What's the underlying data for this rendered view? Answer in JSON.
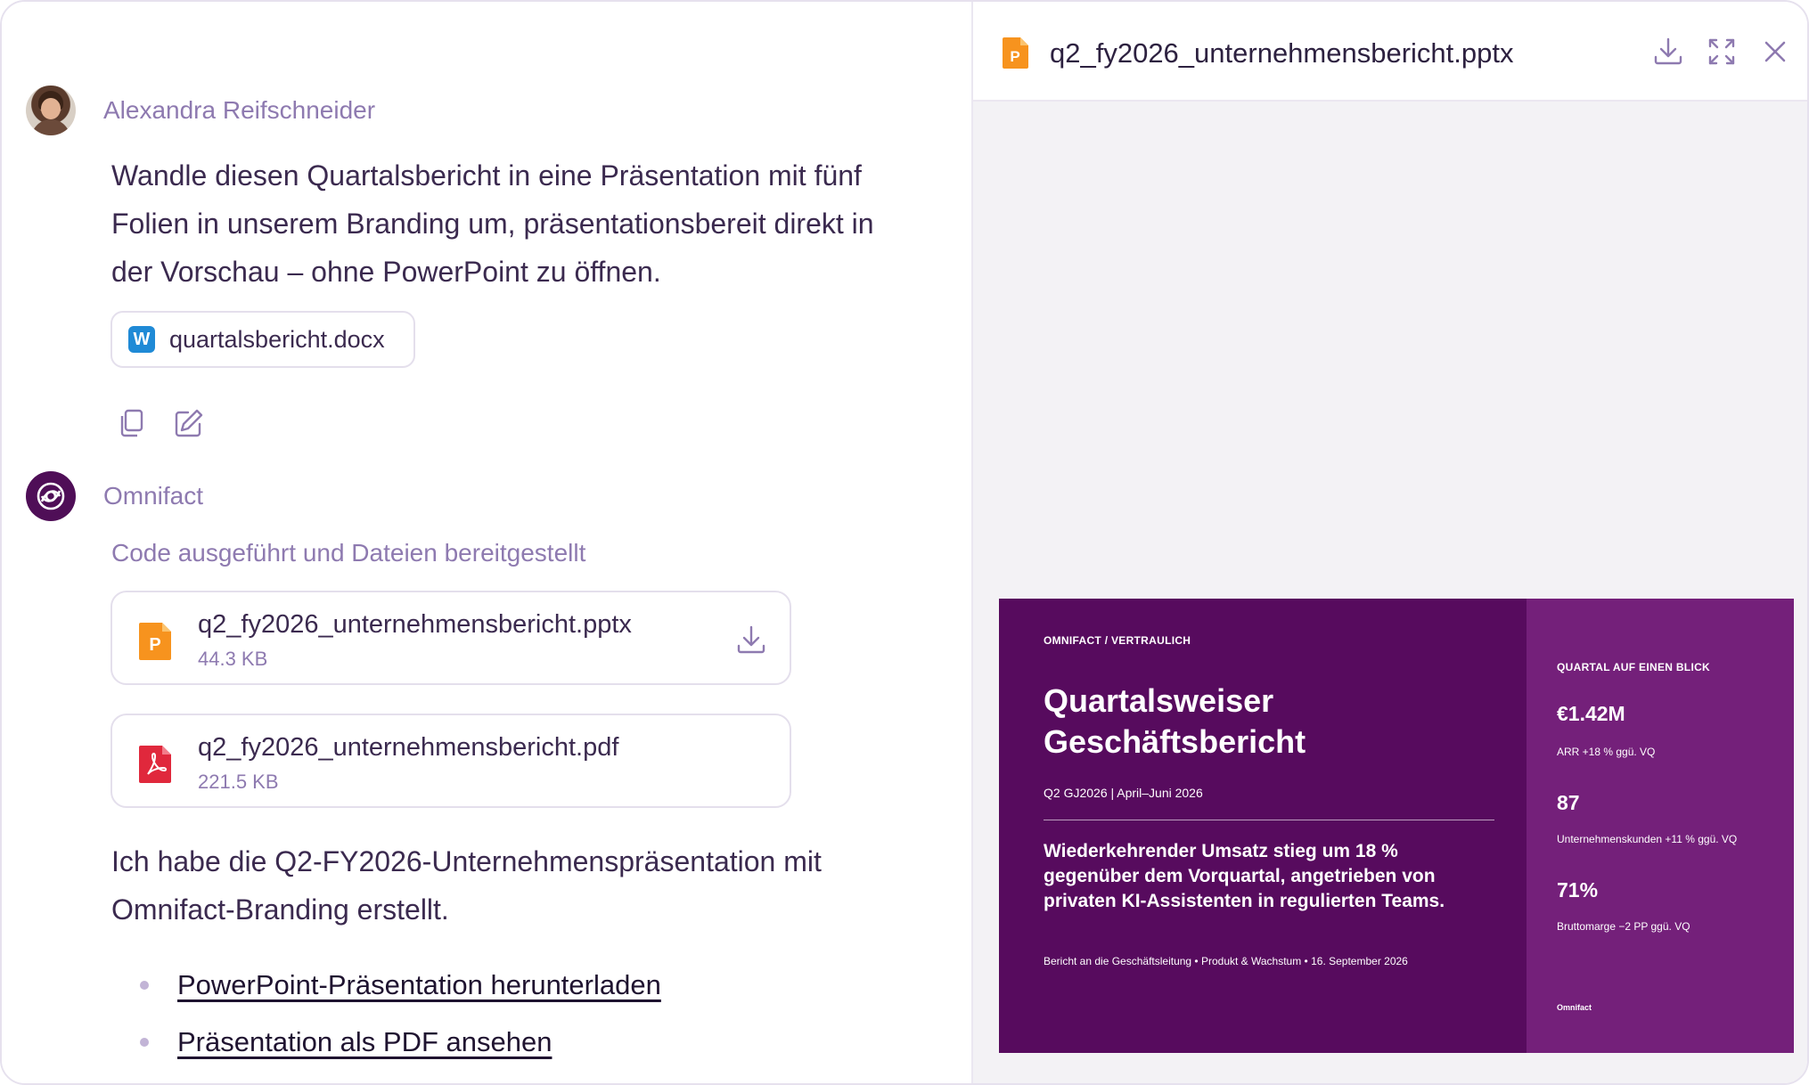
{
  "user": {
    "name": "Alexandra Reifschneider",
    "message": "Wandle diesen Quartalsbericht in eine Präsentation mit fünf Folien in unserem Branding um, präsentationsbereit direkt in der Vorschau – ohne PowerPoint zu öffnen.",
    "attachment": "quartalsbericht.docx"
  },
  "bot": {
    "name": "Omnifact",
    "status": "Code ausgeführt und Dateien bereitgestellt",
    "files": [
      {
        "name": "q2_fy2026_unternehmensbericht.pptx",
        "size": "44.3 KB",
        "icon": "pptx-icon"
      },
      {
        "name": "q2_fy2026_unternehmensbericht.pdf",
        "size": "221.5 KB",
        "icon": "pdf-icon"
      }
    ],
    "message": "Ich habe die Q2-FY2026-Unternehmenspräsentation mit Omnifact-Branding erstellt.",
    "links": [
      "PowerPoint-Präsentation herunterladen",
      "Präsentation als PDF ansehen"
    ]
  },
  "preview": {
    "title": "q2_fy2026_unternehmensbericht.pptx",
    "slide": {
      "tag": "OMNIFACT / VERTRAULICH",
      "title": "Quartalsweiser Geschäftsbericht",
      "subtitle": "Q2 GJ2026 | April–Juni 2026",
      "body": "Wiederkehrender Umsatz stieg um 18 % gegenüber dem Vorquartal, angetrieben von privaten KI-Assistenten in regulierten Teams.",
      "footer": "Bericht an die Geschäftsleitung  •  Produkt & Wachstum  •  16. September 2026",
      "side_heading": "QUARTAL AUF EINEN BLICK",
      "metrics": [
        {
          "value": "€1.42M",
          "caption": "ARR  +18 % ggü. VQ"
        },
        {
          "value": "87",
          "caption": "Unternehmenskunden  +11 % ggü. VQ"
        },
        {
          "value": "71%",
          "caption": "Bruttomarge  −2 PP ggü. VQ"
        }
      ],
      "brand": "Omnifact"
    }
  },
  "colors": {
    "accent_purple": "#570b5e",
    "side_purple": "#74207a",
    "muted_text": "#8e7ab0",
    "pptx_orange": "#f7931e",
    "pdf_red": "#e0283c",
    "word_blue": "#1f8ad6"
  }
}
